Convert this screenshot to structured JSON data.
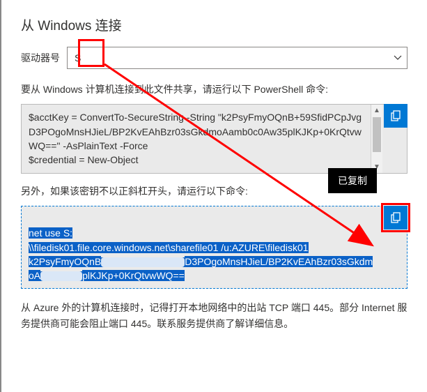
{
  "title": "从 Windows 连接",
  "drive": {
    "label": "驱动器号",
    "value": "S"
  },
  "desc1": "要从 Windows 计算机连接到此文件共享，请运行以下 PowerShell 命令:",
  "code1": "$acctKey = ConvertTo-SecureString -String \"k2PsyFmyOQnB+59SfidPCpJvgD3POgoMnsHJieL/BP2KvEAhBzr03sGkdmoAamb0c0Aw35plKJKp+0KrQtvwWQ==\" -AsPlainText -Force\n$credential = New-Object",
  "desc2": "另外，如果该密钥不以正斜杠开头，请运行以下命令:",
  "code2": {
    "line1": "net use S:",
    "line2": "\\\\filedisk01.file.core.windows.net\\sharefile01 /u:AZURE\\filedisk01",
    "line3a": "k2PsyFmyOQnB",
    "line3b": "D3POgoMnsHJieL/BP2KvEAhBzr03sGkdmoA",
    "line3c": "plKJKp+0KrQtvwWQ=="
  },
  "tooltip": "已复制",
  "desc3": "从 Azure 外的计算机连接时，记得打开本地网络中的出站 TCP 端口 445。部分 Internet 服务提供商可能会阻止端口 445。联系服务提供商了解详细信息。"
}
